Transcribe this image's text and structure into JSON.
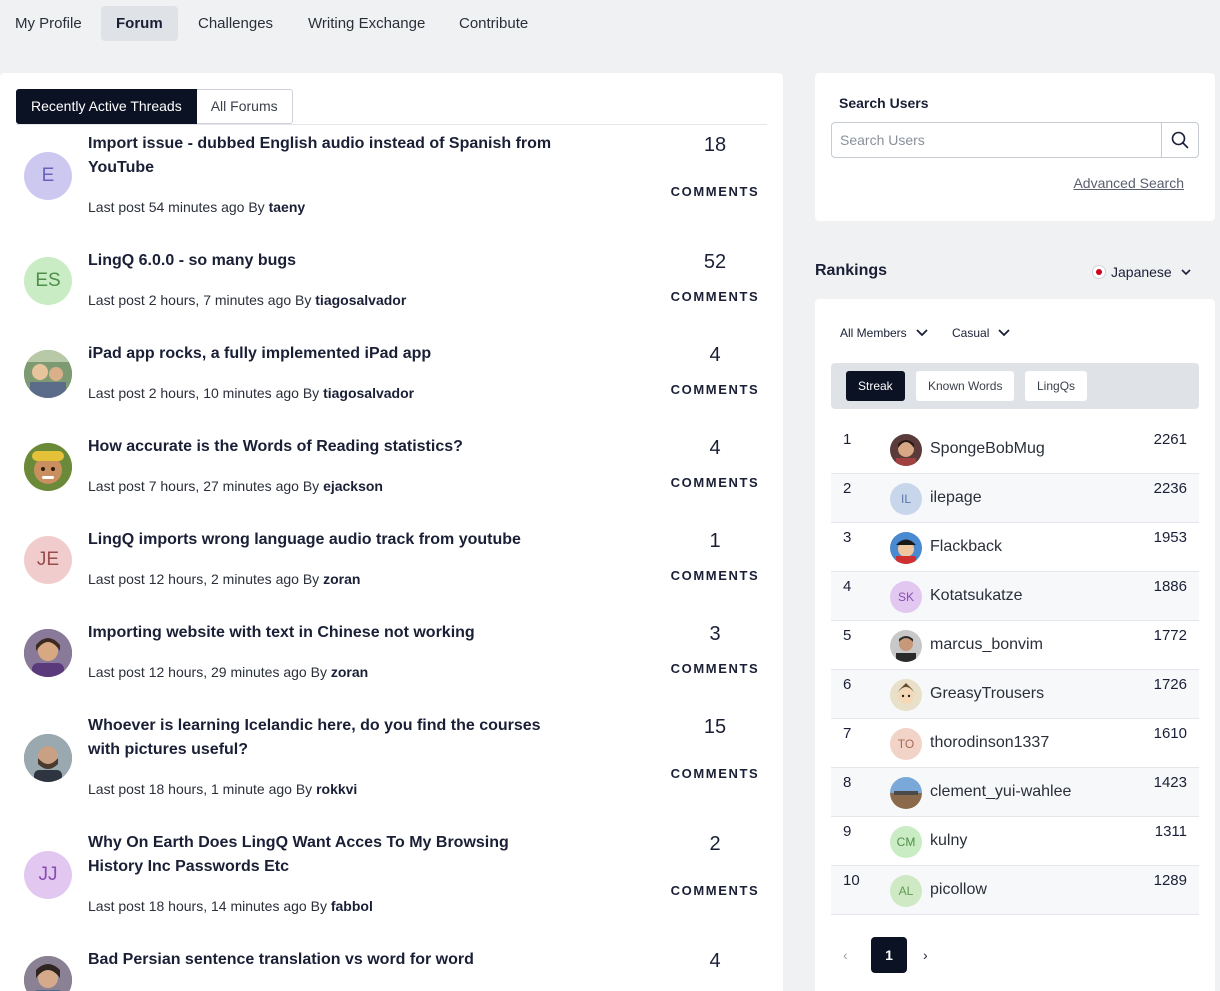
{
  "nav": {
    "items": [
      "My Profile",
      "Forum",
      "Challenges",
      "Writing Exchange",
      "Contribute"
    ]
  },
  "forum": {
    "tabs": [
      "Recently Active Threads",
      "All Forums"
    ],
    "last_post_prefix": "Last post",
    "by": "By",
    "comments_label": "COMMENTS",
    "threads": [
      {
        "title": "Import issue - dubbed English audio instead of Spanish from YouTube",
        "time": "54 minutes ago",
        "author": "taeny",
        "comments": "18",
        "avatar": "E"
      },
      {
        "title": "LingQ 6.0.0 - so many bugs",
        "time": "2 hours, 7 minutes ago",
        "author": "tiagosalvador",
        "comments": "52",
        "avatar": "ES"
      },
      {
        "title": "iPad app rocks, a fully implemented iPad app",
        "time": "2 hours, 10 minutes ago",
        "author": "tiagosalvador",
        "comments": "4",
        "avatar": ""
      },
      {
        "title": "How accurate is the Words of Reading statistics?",
        "time": "7 hours, 27 minutes ago",
        "author": "ejackson",
        "comments": "4",
        "avatar": ""
      },
      {
        "title": "LingQ imports wrong language audio track from youtube",
        "time": "12 hours, 2 minutes ago",
        "author": "zoran",
        "comments": "1",
        "avatar": "JE"
      },
      {
        "title": "Importing website with text in Chinese not working",
        "time": "12 hours, 29 minutes ago",
        "author": "zoran",
        "comments": "3",
        "avatar": ""
      },
      {
        "title": "Whoever is learning Icelandic here, do you find the courses with pictures useful?",
        "time": "18 hours, 1 minute ago",
        "author": "rokkvi",
        "comments": "15",
        "avatar": ""
      },
      {
        "title": "Why On Earth Does LingQ Want Acces To My Browsing History Inc Passwords Etc",
        "time": "18 hours, 14 minutes ago",
        "author": "fabbol",
        "comments": "2",
        "avatar": "JJ"
      },
      {
        "title": "Bad Persian sentence translation vs word for word",
        "time": "",
        "author": "",
        "comments": "4",
        "avatar": ""
      }
    ]
  },
  "search": {
    "heading": "Search Users",
    "placeholder": "Search Users",
    "advanced": "Advanced Search"
  },
  "rankings": {
    "heading": "Rankings",
    "language": "Japanese",
    "filters": [
      "All Members",
      "Casual"
    ],
    "segments": [
      "Streak",
      "Known Words",
      "LingQs"
    ],
    "active_segment": "Streak",
    "rows": [
      {
        "rank": "1",
        "name": "SpongeBobMug",
        "score": "2261",
        "avatar": ""
      },
      {
        "rank": "2",
        "name": "ilepage",
        "score": "2236",
        "avatar": "IL"
      },
      {
        "rank": "3",
        "name": "Flackback",
        "score": "1953",
        "avatar": ""
      },
      {
        "rank": "4",
        "name": "Kotatsukatze",
        "score": "1886",
        "avatar": "SK"
      },
      {
        "rank": "5",
        "name": "marcus_bonvim",
        "score": "1772",
        "avatar": ""
      },
      {
        "rank": "6",
        "name": "GreasyTrousers",
        "score": "1726",
        "avatar": ""
      },
      {
        "rank": "7",
        "name": "thorodinson1337",
        "score": "1610",
        "avatar": "TO"
      },
      {
        "rank": "8",
        "name": "clement_yui-wahlee",
        "score": "1423",
        "avatar": ""
      },
      {
        "rank": "9",
        "name": "kulny",
        "score": "1311",
        "avatar": "CM"
      },
      {
        "rank": "10",
        "name": "picollow",
        "score": "1289",
        "avatar": "AL"
      }
    ],
    "pagination": {
      "prev": "‹",
      "current": "1",
      "next": "›"
    }
  }
}
